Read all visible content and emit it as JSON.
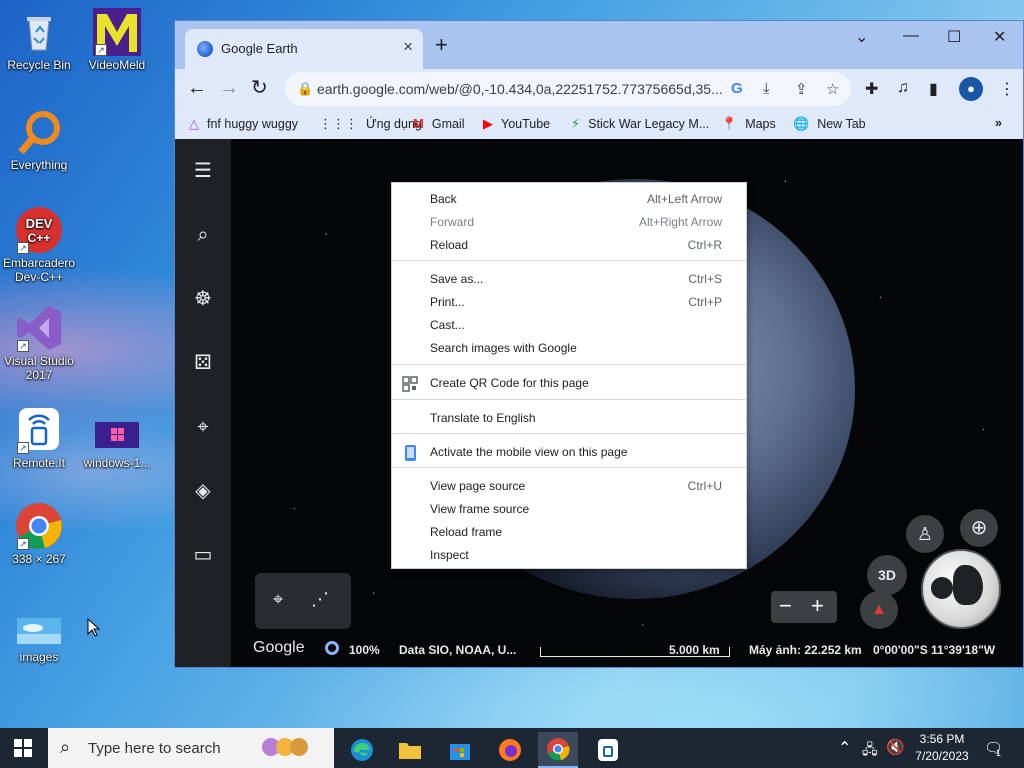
{
  "desktop": {
    "icons": [
      {
        "label": "Recycle Bin"
      },
      {
        "label": "VideoMeld"
      },
      {
        "label": "Everything"
      },
      {
        "label": "Embarcadero Dev-C++"
      },
      {
        "label": "Visual Studio 2017"
      },
      {
        "label": "Remote.It"
      },
      {
        "label": "windows-1..."
      },
      {
        "label": "338 × 267"
      },
      {
        "label": "images"
      }
    ]
  },
  "browser": {
    "tab_title": "Google Earth",
    "url": "earth.google.com/web/@0,-10.434,0a,22251752.77375665d,35...",
    "bookmarks": [
      {
        "label": "fnf huggy wuggy",
        "icon": "triangle-icon"
      },
      {
        "label": "Ứng dụng",
        "icon": "apps-grid-icon"
      },
      {
        "label": "Gmail",
        "icon": "gmail-icon"
      },
      {
        "label": "YouTube",
        "icon": "youtube-icon"
      },
      {
        "label": "Stick War Legacy M...",
        "icon": "bolt-icon"
      },
      {
        "label": "Maps",
        "icon": "maps-pin-icon"
      },
      {
        "label": "New Tab",
        "icon": "globe-icon"
      }
    ]
  },
  "earth": {
    "status": {
      "logo": "Google",
      "zoom": "100%",
      "data": "Data SIO, NOAA, U...",
      "scale": "5.000 km",
      "camera": "Máy ảnh: 22.252 km",
      "coords": "0°00'00\"S 11°39'18\"W"
    },
    "btn_3d": "3D"
  },
  "context_menu": {
    "items": [
      {
        "label": "Back",
        "shortcut": "Alt+Left Arrow",
        "disabled": false
      },
      {
        "label": "Forward",
        "shortcut": "Alt+Right Arrow",
        "disabled": true
      },
      {
        "label": "Reload",
        "shortcut": "Ctrl+R",
        "disabled": false
      },
      {
        "label": "Save as...",
        "shortcut": "Ctrl+S",
        "disabled": false
      },
      {
        "label": "Print...",
        "shortcut": "Ctrl+P",
        "disabled": false
      },
      {
        "label": "Cast...",
        "shortcut": "",
        "disabled": false
      },
      {
        "label": "Search images with Google",
        "shortcut": "",
        "disabled": false
      },
      {
        "label": "Create QR Code for this page",
        "shortcut": "",
        "disabled": false
      },
      {
        "label": "Translate to English",
        "shortcut": "",
        "disabled": false
      },
      {
        "label": "Activate the mobile view on this page",
        "shortcut": "",
        "disabled": false
      },
      {
        "label": "View page source",
        "shortcut": "Ctrl+U",
        "disabled": false
      },
      {
        "label": "View frame source",
        "shortcut": "",
        "disabled": false
      },
      {
        "label": "Reload frame",
        "shortcut": "",
        "disabled": false
      },
      {
        "label": "Inspect",
        "shortcut": "",
        "disabled": false
      }
    ]
  },
  "taskbar": {
    "search_placeholder": "Type here to search",
    "time": "3:56 PM",
    "date": "7/20/2023",
    "notification_count": "1"
  }
}
